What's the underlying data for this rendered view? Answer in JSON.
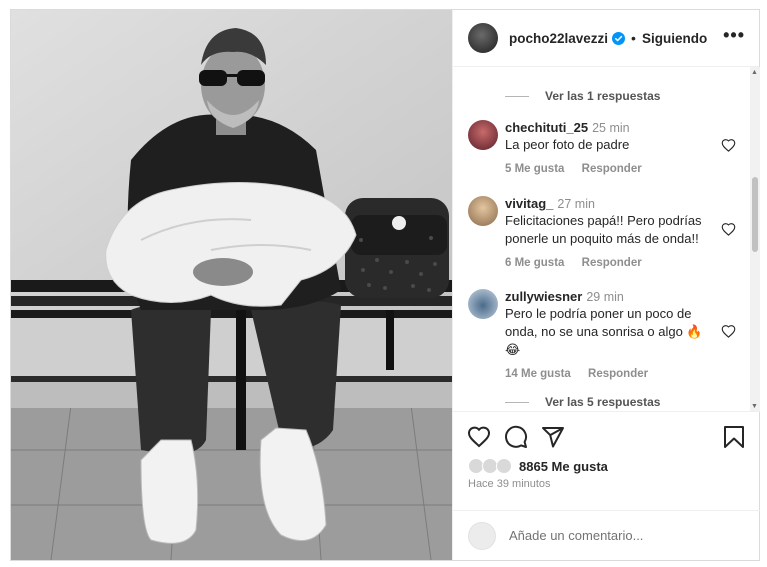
{
  "post": {
    "author": "pocho22lavezzi",
    "separator": "•",
    "follow_status": "Siguiendo",
    "more_label": "•••"
  },
  "comments": {
    "view_replies_top": "Ver las 1 respuestas",
    "items": [
      {
        "user": "chechituti_25",
        "time": "25 min",
        "text": "La peor foto de padre",
        "likes": "5 Me gusta",
        "reply": "Responder"
      },
      {
        "user": "vivitag_",
        "time": "27 min",
        "text": "Felicitaciones papá!! Pero podrías ponerle un poquito más de onda!!",
        "likes": "6 Me gusta",
        "reply": "Responder"
      },
      {
        "user": "zullywiesner",
        "time": "29 min",
        "text": "Pero le podría poner un poco de onda, no se una sonrisa o algo 🔥😂",
        "likes": "14 Me gusta",
        "reply": "Responder"
      }
    ],
    "view_replies_bottom": "Ver las 5 respuestas"
  },
  "footer": {
    "likes_count": "8865 Me gusta",
    "posted_ago": "Hace 39 minutos",
    "comment_placeholder": "Añade un comentario..."
  },
  "icons": {
    "like": "heart-icon",
    "comment": "comment-icon",
    "share": "share-icon",
    "save": "bookmark-icon",
    "verified": "verified-badge-icon"
  },
  "colors": {
    "verified_blue": "#0095f6",
    "text": "#262626",
    "muted": "#8e8e8e"
  }
}
